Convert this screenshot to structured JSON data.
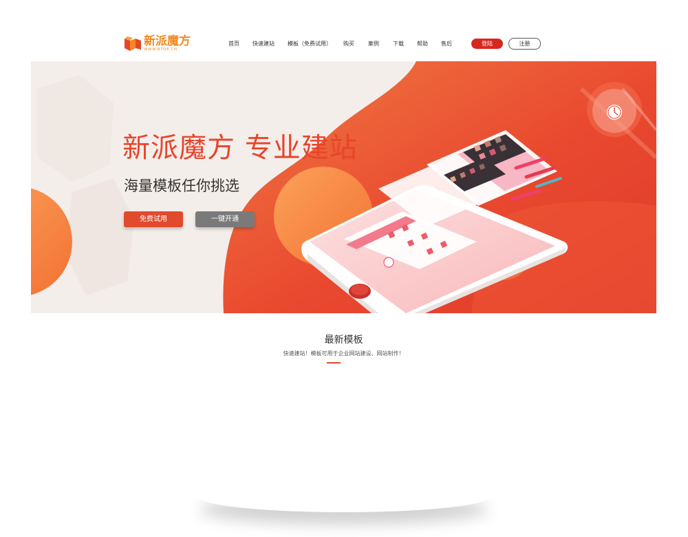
{
  "brand": {
    "name": "新派魔方",
    "url_text": "WWW.BTOE.CN",
    "colors": {
      "logo": "#f08a23",
      "accent": "#d8271f",
      "banner_red": "#e8442b"
    }
  },
  "nav": {
    "items": [
      "首页",
      "快速建站",
      "模板（免费试用）",
      "购买",
      "案例",
      "下载",
      "帮助",
      "售后"
    ],
    "login_label": "登陆",
    "register_label": "注册"
  },
  "hero": {
    "title": "新派魔方  专业建站",
    "subtitle": "海量模板任你挑选",
    "trial_button": "免费试用",
    "open_button": "一键开通",
    "illustration": "phone-with-cosmetics-icon"
  },
  "section": {
    "title": "最新模板",
    "subtitle": "快速建站！模板可用于企业网站建设、网站制作！"
  }
}
